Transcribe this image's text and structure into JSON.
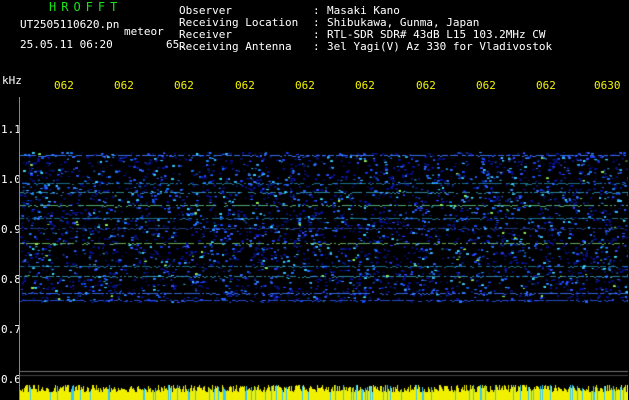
{
  "header": {
    "brand": "HROFFT",
    "file_name": "UT2505110620.pn",
    "product": "meteor",
    "datetime": "25.05.11 06:20",
    "signal_level": "65."
  },
  "metadata": [
    {
      "label": "Observer",
      "value": "Masaki Kano"
    },
    {
      "label": "Receiving Location",
      "value": "Shibukawa, Gunma, Japan"
    },
    {
      "label": "Receiver",
      "value": "RTL-SDR SDR# 43dB L15 103.2MHz CW"
    },
    {
      "label": "Receiving Antenna",
      "value": "3el Yagi(V) Az 330 for Vladivostok"
    }
  ],
  "axes": {
    "y_unit": "kHz",
    "y_ticks": [
      "1.1",
      "1.0",
      "0.9",
      "0.8",
      "0.7",
      "0.6"
    ],
    "x_ticks": [
      "062",
      "062",
      "062",
      "062",
      "062",
      "062",
      "062",
      "062",
      "062",
      "0630"
    ]
  },
  "colors": {
    "label_green": "#19e319",
    "label_yellow": "#f4f400",
    "spectrum_dark": "#00003c",
    "spectrum_blue": "#1e46ff",
    "spectrum_cyan": "#32c8ff",
    "echo_green": "#9cf05a",
    "level_bar": "#f0f000"
  }
}
